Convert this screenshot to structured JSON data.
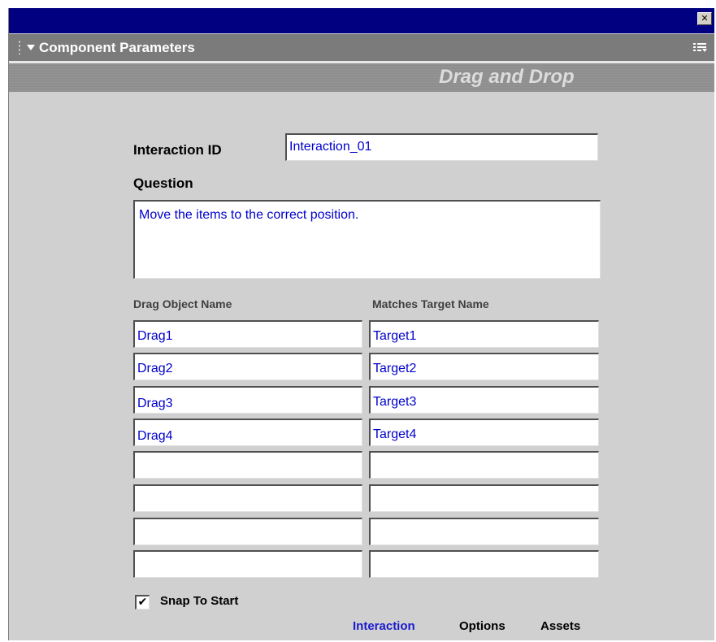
{
  "window": {
    "close_glyph": "✕"
  },
  "panel": {
    "title": "Component Parameters",
    "collapse_icon": "triangle-down-icon",
    "menu_icon": "options-menu-icon"
  },
  "banner": {
    "title": "Drag and Drop"
  },
  "form": {
    "interaction_id_label": "Interaction ID",
    "interaction_id_value": "Interaction_01",
    "question_label": "Question",
    "question_value": "Move the items to the correct position.",
    "drag_col_header": "Drag Object Name",
    "target_col_header": "Matches Target Name",
    "rows": [
      {
        "drag": "Drag1",
        "target": "Target1"
      },
      {
        "drag": "Drag2",
        "target": "Target2"
      },
      {
        "drag": "Drag3",
        "target": "Target3"
      },
      {
        "drag": "Drag4",
        "target": "Target4"
      },
      {
        "drag": "",
        "target": ""
      },
      {
        "drag": "",
        "target": ""
      },
      {
        "drag": "",
        "target": ""
      },
      {
        "drag": "",
        "target": ""
      }
    ],
    "snap_to_start_label": "Snap To Start",
    "snap_to_start_checked": true,
    "check_glyph": "✔"
  },
  "tabs": [
    {
      "label": "Interaction",
      "active": true,
      "color": "#1a1ad0"
    },
    {
      "label": "Options",
      "active": false,
      "color": "#000000"
    },
    {
      "label": "Assets",
      "active": false,
      "color": "#000000"
    }
  ]
}
